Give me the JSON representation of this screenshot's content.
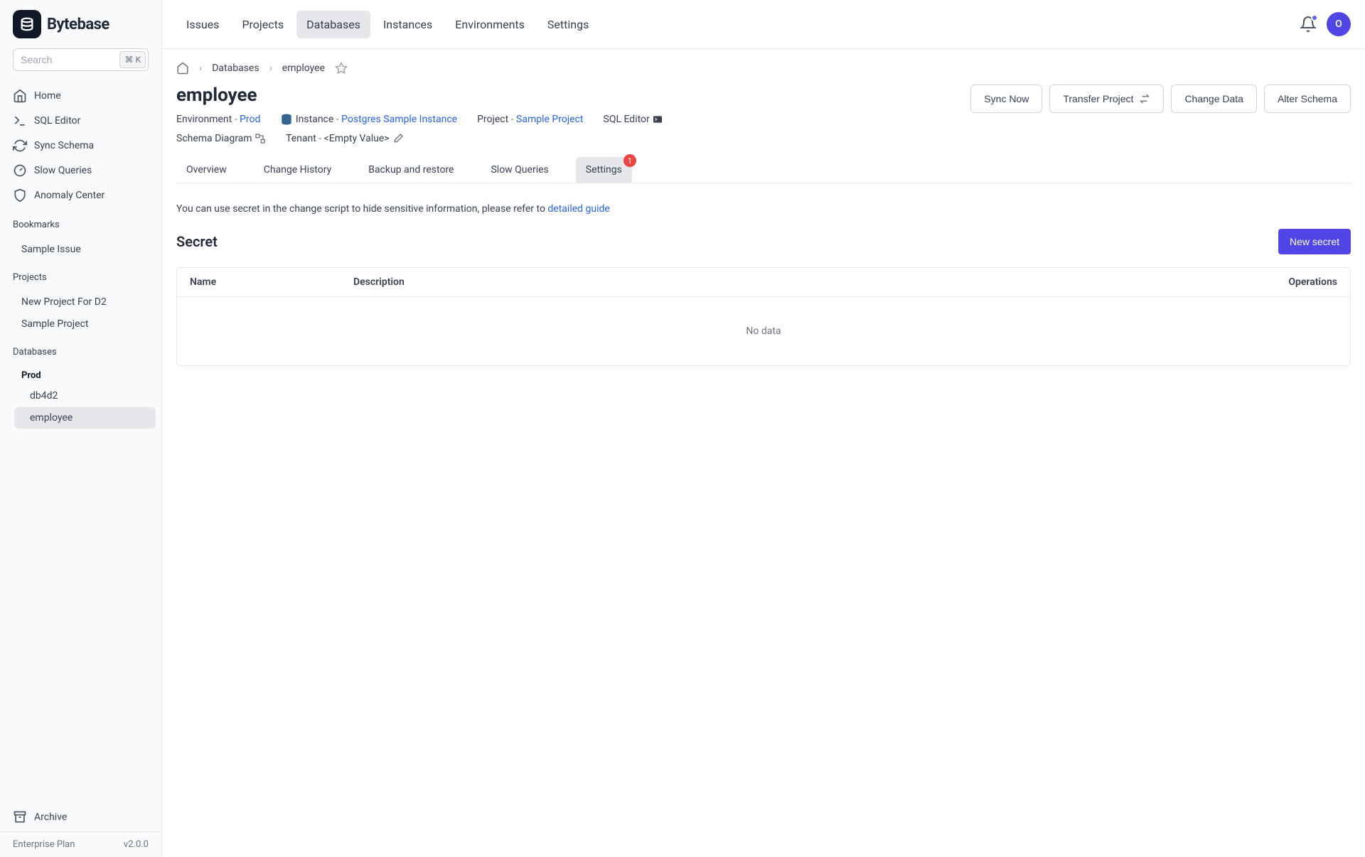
{
  "brand": "Bytebase",
  "search": {
    "placeholder": "Search",
    "kbd": "⌘  K"
  },
  "sidebar_nav": [
    {
      "id": "home",
      "label": "Home"
    },
    {
      "id": "sql-editor",
      "label": "SQL Editor"
    },
    {
      "id": "sync-schema",
      "label": "Sync Schema"
    },
    {
      "id": "slow-queries",
      "label": "Slow Queries"
    },
    {
      "id": "anomaly-center",
      "label": "Anomaly Center"
    }
  ],
  "bookmarks_head": "Bookmarks",
  "bookmarks": [
    {
      "label": "Sample Issue"
    }
  ],
  "projects_head": "Projects",
  "projects": [
    {
      "label": "New Project For D2"
    },
    {
      "label": "Sample Project"
    }
  ],
  "databases_head": "Databases",
  "db_env": "Prod",
  "databases": [
    {
      "label": "db4d2",
      "sel": false
    },
    {
      "label": "employee",
      "sel": true
    }
  ],
  "archive": "Archive",
  "plan": "Enterprise Plan",
  "version": "v2.0.0",
  "topnav": [
    {
      "id": "issues",
      "label": "Issues"
    },
    {
      "id": "projects",
      "label": "Projects"
    },
    {
      "id": "databases",
      "label": "Databases",
      "active": true
    },
    {
      "id": "instances",
      "label": "Instances"
    },
    {
      "id": "environments",
      "label": "Environments"
    },
    {
      "id": "settings",
      "label": "Settings"
    }
  ],
  "avatar": "O",
  "crumbs": {
    "home": "home",
    "parent": "Databases",
    "leaf": "employee"
  },
  "page_title": "employee",
  "meta": {
    "env_label": "Environment",
    "env_value": "Prod",
    "instance_label": "Instance",
    "instance_value": "Postgres Sample Instance",
    "project_label": "Project",
    "project_value": "Sample Project",
    "sql_editor_label": "SQL Editor",
    "schema_diagram_label": "Schema Diagram",
    "tenant_label": "Tenant",
    "tenant_value": "<Empty Value>"
  },
  "actions": {
    "sync_now": "Sync Now",
    "transfer_project": "Transfer Project",
    "change_data": "Change Data",
    "alter_schema": "Alter Schema"
  },
  "subtabs": [
    {
      "id": "overview",
      "label": "Overview"
    },
    {
      "id": "change-history",
      "label": "Change History"
    },
    {
      "id": "backup",
      "label": "Backup and restore"
    },
    {
      "id": "slow-queries",
      "label": "Slow Queries"
    },
    {
      "id": "settings",
      "label": "Settings",
      "active": true,
      "badge": "1"
    }
  ],
  "settings_desc_prefix": "You can use secret in the change script to hide sensitive information, please refer to ",
  "settings_desc_link": "detailed guide",
  "secret_heading": "Secret",
  "new_secret": "New secret",
  "table_headers": {
    "name": "Name",
    "description": "Description",
    "operations": "Operations"
  },
  "no_data": "No data"
}
